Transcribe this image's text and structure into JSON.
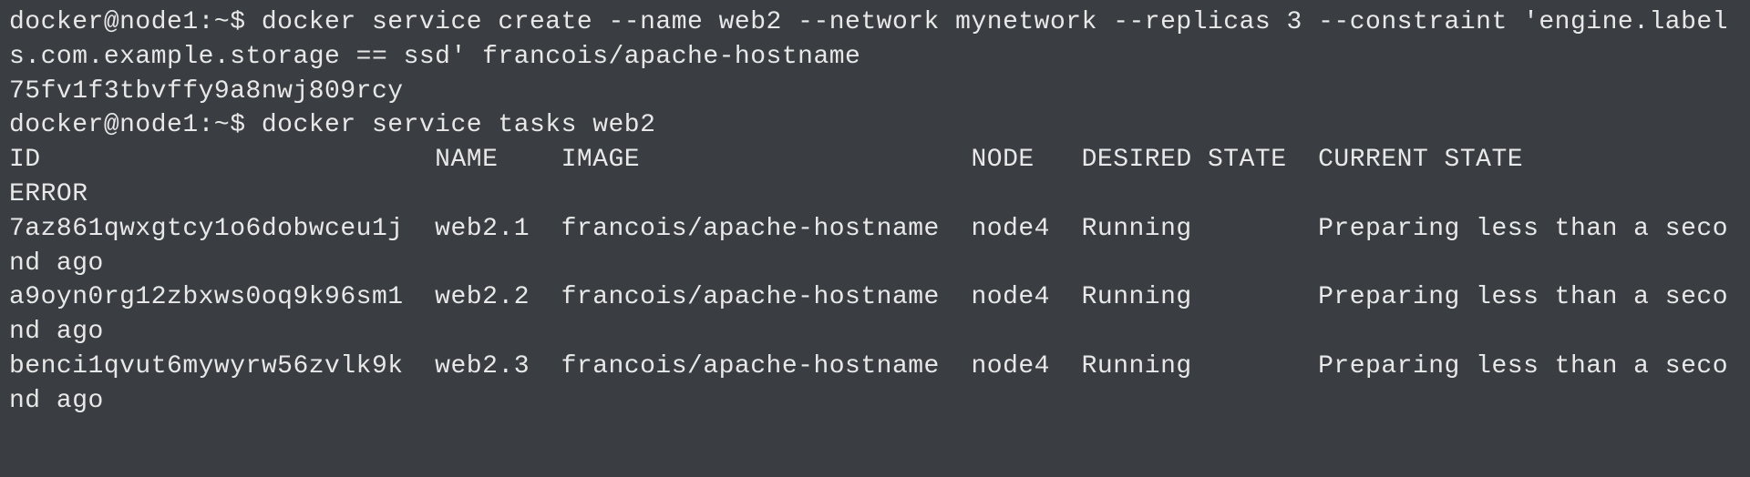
{
  "terminal": {
    "prompt1": "docker@node1:~$ ",
    "command1": "docker service create --name web2 --network mynetwork --replicas 3 --constraint 'engine.labels.com.example.storage == ssd' francois/apache-hostname",
    "output1": "75fv1f3tbvffy9a8nwj809rcy",
    "prompt2": "docker@node1:~$ ",
    "command2": "docker service tasks web2",
    "header": "ID                         NAME    IMAGE                     NODE   DESIRED STATE  CURRENT STATE               ERROR",
    "rows": [
      "7az861qwxgtcy1o6dobwceu1j  web2.1  francois/apache-hostname  node4  Running        Preparing less than a second ago",
      "a9oyn0rg12zbxws0oq9k96sm1  web2.2  francois/apache-hostname  node4  Running        Preparing less than a second ago",
      "benci1qvut6mywyrw56zvlk9k  web2.3  francois/apache-hostname  node4  Running        Preparing less than a second ago"
    ]
  },
  "chart_data": {
    "type": "table",
    "title": "docker service tasks web2",
    "columns": [
      "ID",
      "NAME",
      "IMAGE",
      "NODE",
      "DESIRED STATE",
      "CURRENT STATE",
      "ERROR"
    ],
    "rows": [
      [
        "7az861qwxgtcy1o6dobwceu1j",
        "web2.1",
        "francois/apache-hostname",
        "node4",
        "Running",
        "Preparing less than a second ago",
        ""
      ],
      [
        "a9oyn0rg12zbxws0oq9k96sm1",
        "web2.2",
        "francois/apache-hostname",
        "node4",
        "Running",
        "Preparing less than a second ago",
        ""
      ],
      [
        "benci1qvut6mywyrw56zvlk9k",
        "web2.3",
        "francois/apache-hostname",
        "node4",
        "Running",
        "Preparing less than a second ago",
        ""
      ]
    ]
  }
}
